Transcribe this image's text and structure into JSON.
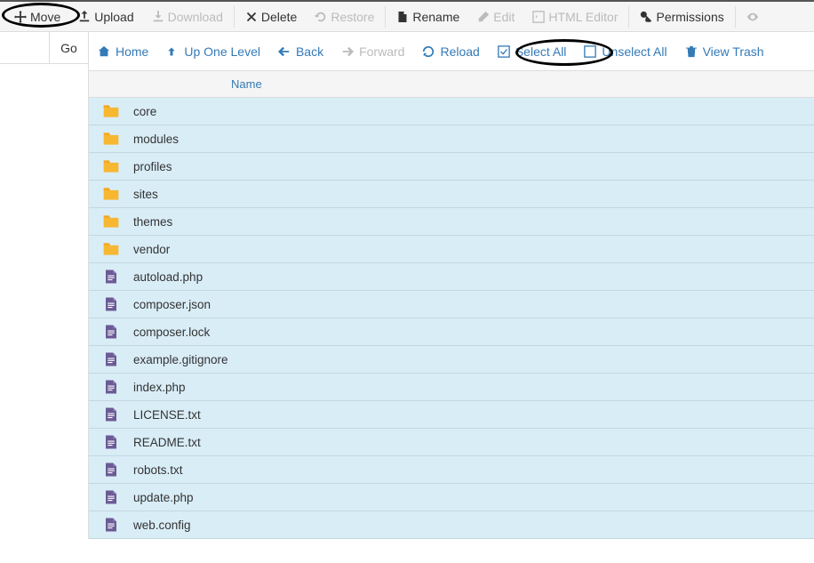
{
  "toolbar": {
    "move": "Move",
    "upload": "Upload",
    "download": "Download",
    "delete": "Delete",
    "restore": "Restore",
    "rename": "Rename",
    "edit": "Edit",
    "html_editor": "HTML Editor",
    "permissions": "Permissions"
  },
  "go_button": "Go",
  "nav": {
    "home": "Home",
    "up": "Up One Level",
    "back": "Back",
    "forward": "Forward",
    "reload": "Reload",
    "select_all": "Select All",
    "unselect_all": "Unselect All",
    "view_trash": "View Trash"
  },
  "columns": {
    "name": "Name"
  },
  "files": [
    {
      "name": "core",
      "type": "folder"
    },
    {
      "name": "modules",
      "type": "folder"
    },
    {
      "name": "profiles",
      "type": "folder"
    },
    {
      "name": "sites",
      "type": "folder"
    },
    {
      "name": "themes",
      "type": "folder"
    },
    {
      "name": "vendor",
      "type": "folder"
    },
    {
      "name": "autoload.php",
      "type": "file"
    },
    {
      "name": "composer.json",
      "type": "file"
    },
    {
      "name": "composer.lock",
      "type": "file"
    },
    {
      "name": "example.gitignore",
      "type": "file"
    },
    {
      "name": "index.php",
      "type": "file"
    },
    {
      "name": "LICENSE.txt",
      "type": "file"
    },
    {
      "name": "README.txt",
      "type": "file"
    },
    {
      "name": "robots.txt",
      "type": "file"
    },
    {
      "name": "update.php",
      "type": "file"
    },
    {
      "name": "web.config",
      "type": "file"
    }
  ]
}
